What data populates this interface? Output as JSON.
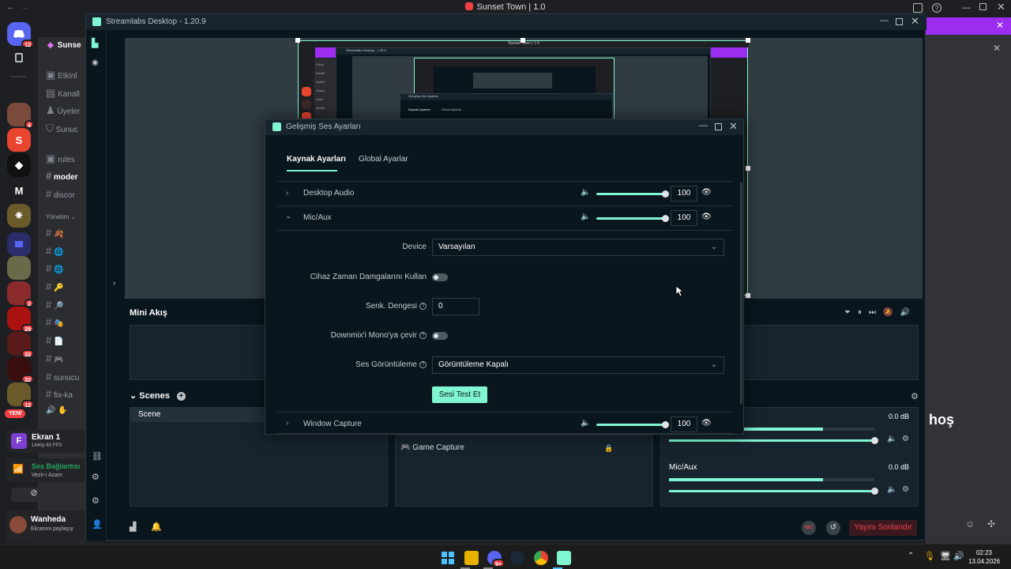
{
  "discord": {
    "window_title": "Sunset Town | 1.0",
    "server_badges": [
      "12",
      "4",
      "2",
      "29",
      "22",
      "22",
      "12"
    ],
    "server_letter": "M",
    "server_name_partial": "Sunse",
    "channels_top": [
      "Etkinl",
      "Kanall",
      "Üyeler",
      "Sunuc"
    ],
    "channels_text": [
      "rules",
      "moder",
      "discor"
    ],
    "category": "Yönetim",
    "channels_bottom": [
      "sunucu",
      "fix-ka"
    ],
    "new_label": "YENİ",
    "screen_share": {
      "title": "Ekran 1",
      "subtitle": "1440p 60 FPS",
      "letter": "F"
    },
    "voice": {
      "status": "Ses Bağlantısı",
      "channel": "Vezir-i Azam"
    },
    "user": {
      "name": "Wanheda",
      "status": "Ekranını paylaşıy"
    },
    "right_text": "hoş"
  },
  "slobs": {
    "title": "Streamlabs Desktop - 1.20.9",
    "mini_feed": "Mini Akış",
    "scenes_label": "Scenes",
    "scene_column": "Scene",
    "source_item": "Game Capture",
    "mixer": [
      {
        "name": "",
        "db": "0.0 dB",
        "level": 0.75
      },
      {
        "name": "Mic/Aux",
        "db": "0.0 dB",
        "level": 0.75
      }
    ],
    "end_stream": "Yayını Sonlandır",
    "rec_label": "REC"
  },
  "modal": {
    "title": "Gelişmiş Ses Ayarları",
    "tabs": [
      {
        "label": "Kaynak Ayarları",
        "active": true
      },
      {
        "label": "Global Ayarlar",
        "active": false
      }
    ],
    "sources": [
      {
        "name": "Desktop Audio",
        "volume": "100",
        "expanded": false
      },
      {
        "name": "Mic/Aux",
        "volume": "100",
        "expanded": true
      },
      {
        "name": "Window Capture",
        "volume": "100",
        "expanded": false
      }
    ],
    "device_label": "Device",
    "device_value": "Varsayılan",
    "timestamp_label": "Cihaz Zaman Damgalarını Kullan",
    "sync_label": "Senk. Dengesi",
    "sync_value": "0",
    "downmix_label": "Downmix'i Mono'ya çevir",
    "monitor_label": "Ses Görüntüleme",
    "monitor_value": "Görüntüleme Kapalı",
    "test_button": "Sesi Test Et",
    "help_glyph": "?"
  },
  "nested_preview": {
    "title_small": "Streamlabs Desktop - 1.20.9",
    "dialog_small": "Gelişmiş Ses Ayarları",
    "tab1": "Kaynak Ayarları",
    "tab2": "Global Ayarlar",
    "window_title_small": "Sunset Town | 1.0",
    "chan_small": [
      "Etkinl",
      "Kanall",
      "Üyeler",
      "Sunuc",
      "rules",
      "moder"
    ]
  },
  "taskbar": {
    "time": "02:23",
    "date": "13.04.2026",
    "discord_badge": "9+"
  },
  "colors": {
    "accent": "#80f5d2",
    "discord_purple": "#9b2cf0",
    "danger": "#f23f43"
  }
}
